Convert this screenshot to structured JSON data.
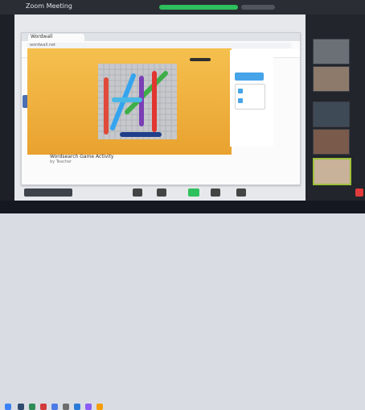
{
  "window": {
    "title": "Zoom Meeting"
  },
  "browser": {
    "tab_title": "Wordwall",
    "address": "wordwall.net"
  },
  "activity": {
    "title": "Wordsearch Game Activity",
    "subtitle": "by Teacher"
  },
  "participants": {
    "names": [
      "",
      "",
      "",
      "",
      ""
    ]
  },
  "colors": {
    "stage_orange": "#f0b23a",
    "zoom_green": "#2ec05c",
    "sidebar_blue": "#46a4e8",
    "active_speaker": "#9cc13a"
  },
  "icons": {
    "mic": "mic-icon",
    "video": "video-icon",
    "share": "share-screen-icon",
    "participants": "participants-icon",
    "chat": "chat-icon",
    "end": "end-call-icon"
  }
}
